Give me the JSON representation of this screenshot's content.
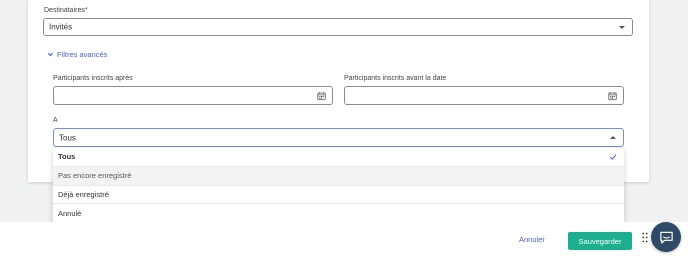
{
  "form": {
    "destinataires_label": "Destinataires*",
    "destinataires_value": "Invités",
    "advanced_filters_label": "Filtres avancés",
    "after_label": "Participants inscrits après",
    "after_value": "",
    "before_label": "Participants inscrits avant la date",
    "before_value": "",
    "a_label": "A",
    "a_value": "Tous"
  },
  "dropdown": {
    "options": [
      {
        "label": "Tous",
        "selected": true
      },
      {
        "label": "Pas encore enregistré",
        "selected": false
      },
      {
        "label": "Déjà enregistré",
        "selected": false
      },
      {
        "label": "Annulé",
        "selected": false
      }
    ]
  },
  "footer": {
    "cancel_label": "Annuler",
    "save_label": "Sauvegarder"
  },
  "colors": {
    "accent": "#4a5ed6",
    "save_button": "#1cae8e",
    "chat_bubble": "#2e4a66"
  },
  "icons": [
    "chevron-down-icon",
    "calendar-icon",
    "check-icon",
    "drag-handle-icon",
    "chat-icon"
  ]
}
